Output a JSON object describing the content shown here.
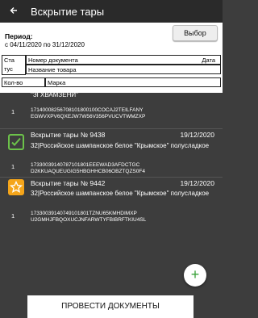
{
  "toolbar": {
    "title": "Вскрытие тары"
  },
  "filter": {
    "period_label": "Период:",
    "period_value": "с 04/11/2020 по 31/12/2020",
    "select_button": "Выбор"
  },
  "table_header": {
    "status": "Ста тус",
    "status_line1": "Ста",
    "status_line2": "тус",
    "doc_number": "Номер документа",
    "date": "Дата",
    "product_name": "Название товара",
    "qty": "Кол-во",
    "mark": "Марка"
  },
  "items": [
    {
      "partial_name": "\"ЗГХВАМЗЕНИ\"",
      "qty": "1",
      "code_line1": "17140008256708101800100COCAJ2TEILFANY",
      "code_line2": "EGWVXPV6QXEJW7W56V356PVUCVTWMZXP"
    },
    {
      "status_icon": "checkmark-icon",
      "title": "Вскрытие тары № 9438",
      "date": "19/12/2020",
      "name": "32|Российское шампанское белое \"Крымское\" полусладкое",
      "qty": "1",
      "code_line1": "17330039140787101801EEEWAD3AFDCTGC",
      "code_line2": "D2KKUAQUEUGIG5HBGHHCB06OBZTQZS0F4"
    },
    {
      "status_icon": "star-icon",
      "title": "Вскрытие тары № 9442",
      "date": "19/12/2020",
      "name": "32|Российское шампанское белое \"Крымское\" полусладкое",
      "qty": "1",
      "code_line1": "17330039140749101801TZNU65KMHDIMXP",
      "code_line2": "U2GMHJFBQOXUCJNFARWTYFBIBRFTKIU4SL"
    }
  ],
  "actions": {
    "fab": "+",
    "submit": "ПРОВЕСТИ ДОКУМЕНТЫ"
  },
  "colors": {
    "done": "#6cc24a",
    "star": "#f5a51a",
    "fab_plus": "#3aa13a"
  }
}
